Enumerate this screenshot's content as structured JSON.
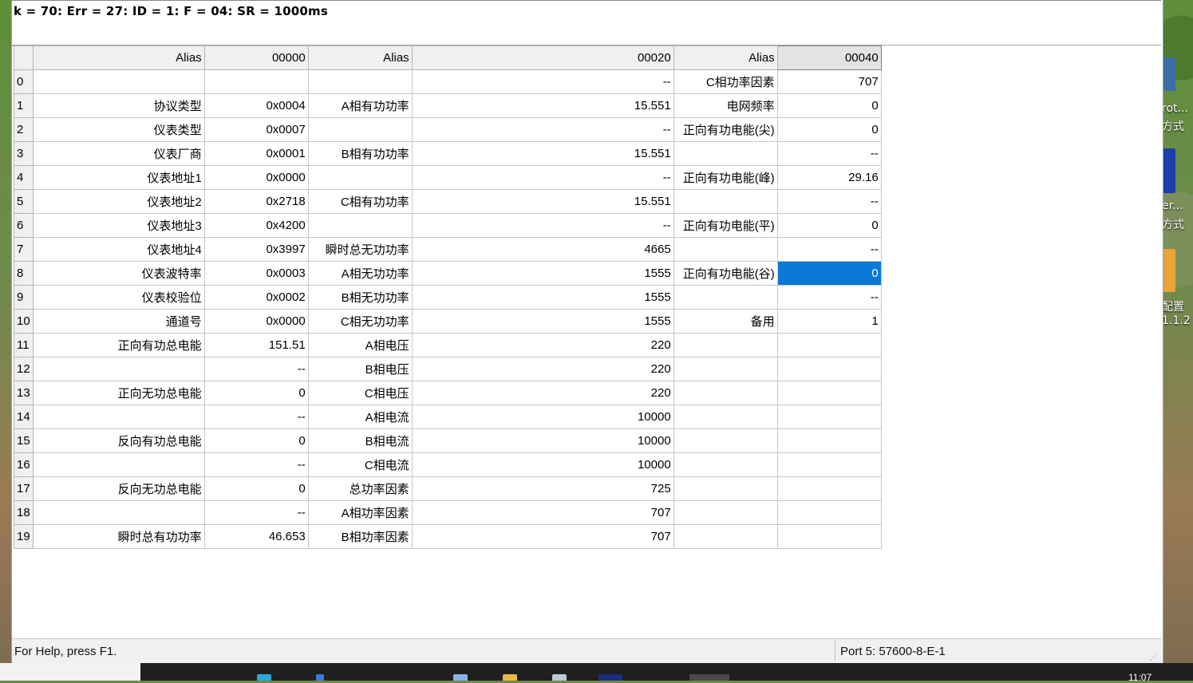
{
  "status_line": "k = 70: Err = 27: ID = 1: F = 04: SR = 1000ms",
  "columns": [
    "Alias",
    "00000",
    "Alias",
    "00020",
    "Alias",
    "00040"
  ],
  "rows": [
    {
      "n": "0",
      "a1": "",
      "v1": "",
      "a2": "",
      "v2": "--",
      "a3": "C相功率因素",
      "v3": "707"
    },
    {
      "n": "1",
      "a1": "协议类型",
      "v1": "0x0004",
      "a2": "A相有功功率",
      "v2": "15.551",
      "a3": "电网频率",
      "v3": "0"
    },
    {
      "n": "2",
      "a1": "仪表类型",
      "v1": "0x0007",
      "a2": "",
      "v2": "--",
      "a3": "正向有功电能(尖)",
      "v3": "0"
    },
    {
      "n": "3",
      "a1": "仪表厂商",
      "v1": "0x0001",
      "a2": "B相有功功率",
      "v2": "15.551",
      "a3": "",
      "v3": "--"
    },
    {
      "n": "4",
      "a1": "仪表地址1",
      "v1": "0x0000",
      "a2": "",
      "v2": "--",
      "a3": "正向有功电能(峰)",
      "v3": "29.16"
    },
    {
      "n": "5",
      "a1": "仪表地址2",
      "v1": "0x2718",
      "a2": "C相有功功率",
      "v2": "15.551",
      "a3": "",
      "v3": "--"
    },
    {
      "n": "6",
      "a1": "仪表地址3",
      "v1": "0x4200",
      "a2": "",
      "v2": "--",
      "a3": "正向有功电能(平)",
      "v3": "0"
    },
    {
      "n": "7",
      "a1": "仪表地址4",
      "v1": "0x3997",
      "a2": "瞬时总无功功率",
      "v2": "4665",
      "a3": "",
      "v3": "--"
    },
    {
      "n": "8",
      "a1": "仪表波特率",
      "v1": "0x0003",
      "a2": "A相无功功率",
      "v2": "1555",
      "a3": "正向有功电能(谷)",
      "v3": "0"
    },
    {
      "n": "9",
      "a1": "仪表校验位",
      "v1": "0x0002",
      "a2": "B相无功功率",
      "v2": "1555",
      "a3": "",
      "v3": "--"
    },
    {
      "n": "10",
      "a1": "通道号",
      "v1": "0x0000",
      "a2": "C相无功功率",
      "v2": "1555",
      "a3": "备用",
      "v3": "1"
    },
    {
      "n": "11",
      "a1": "正向有功总电能",
      "v1": "151.51",
      "a2": "A相电压",
      "v2": "220",
      "a3": "",
      "v3": ""
    },
    {
      "n": "12",
      "a1": "",
      "v1": "--",
      "a2": "B相电压",
      "v2": "220",
      "a3": "",
      "v3": ""
    },
    {
      "n": "13",
      "a1": "正向无功总电能",
      "v1": "0",
      "a2": "C相电压",
      "v2": "220",
      "a3": "",
      "v3": ""
    },
    {
      "n": "14",
      "a1": "",
      "v1": "--",
      "a2": "A相电流",
      "v2": "10000",
      "a3": "",
      "v3": ""
    },
    {
      "n": "15",
      "a1": "反向有功总电能",
      "v1": "0",
      "a2": "B相电流",
      "v2": "10000",
      "a3": "",
      "v3": ""
    },
    {
      "n": "16",
      "a1": "",
      "v1": "--",
      "a2": "C相电流",
      "v2": "10000",
      "a3": "",
      "v3": ""
    },
    {
      "n": "17",
      "a1": "反向无功总电能",
      "v1": "0",
      "a2": "总功率因素",
      "v2": "725",
      "a3": "",
      "v3": ""
    },
    {
      "n": "18",
      "a1": "",
      "v1": "--",
      "a2": "A相功率因素",
      "v2": "707",
      "a3": "",
      "v3": ""
    },
    {
      "n": "19",
      "a1": "瞬时总有功功率",
      "v1": "46.653",
      "a2": "B相功率因素",
      "v2": "707",
      "a3": "",
      "v3": ""
    }
  ],
  "selected_cell": {
    "row": 8,
    "col": "v3"
  },
  "statusbar": {
    "help": "For Help, press F1.",
    "port": "Port 5: 57600-8-E-1"
  },
  "desktop_fragments": [
    "rot...",
    "方式",
    "er...",
    "方式",
    "配置",
    "1.1.2"
  ],
  "clock": "11:07",
  "colors": {
    "selection": "#0a78d7",
    "header_bg": "#f0f0f0",
    "grid_line": "#c8c8c8"
  }
}
